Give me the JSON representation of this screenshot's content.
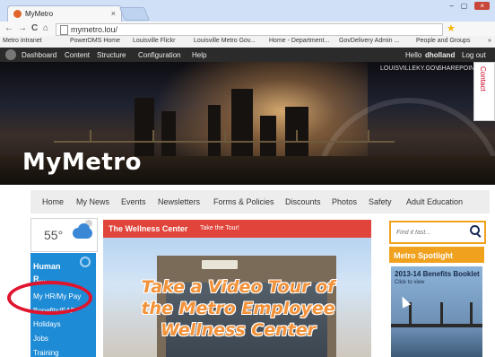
{
  "browser": {
    "tab_title": "MyMetro",
    "tab_close": "×",
    "url": "mymetro.lou/",
    "window_controls": [
      "–",
      "▢",
      "×"
    ],
    "nav": {
      "back": "←",
      "forward": "→",
      "reload": "C",
      "home": "⌂"
    },
    "bookmarks": [
      "Metro Intranet",
      "PowerDMS Home",
      "Louisville Flickr",
      "Louisville Metro Gov...",
      "Home - Department...",
      "GovDelivery Admin ...",
      "People and Groups"
    ],
    "bookmarks_overflow": "»"
  },
  "admin_bar": {
    "items": [
      "Dashboard",
      "Content",
      "Structure",
      "Configuration",
      "Help"
    ],
    "hello": "Hello",
    "user": "dholland",
    "logout": "Log out"
  },
  "top_links": [
    "LOUISVILLEKY.GOV",
    "SHAREPOINT"
  ],
  "site": {
    "logo": "MyMetro",
    "contact": "Contact"
  },
  "main_nav": [
    "Home",
    "My News",
    "Events",
    "Newsletters",
    "Forms & Policies",
    "Discounts",
    "Photos",
    "Safety",
    "Adult Education"
  ],
  "weather": {
    "temp": "55°",
    "icon": "partly-cloudy-icon"
  },
  "hr_panel": {
    "title": "Human",
    "subtitle": "R...",
    "items": [
      "My HR/My Pay",
      "Benefits/EAP",
      "Holidays",
      "Jobs",
      "Training"
    ]
  },
  "wellness": {
    "header": "The Wellness Center",
    "tour_link": "Take the Tour!",
    "overlay_lines": [
      "Take a Video Tour of",
      "the Metro Employee",
      "Wellness Center"
    ]
  },
  "search": {
    "placeholder": "Find it fast..."
  },
  "spotlight": {
    "header": "Metro Spotlight",
    "image_title": "2013-14 Benefits Booklet",
    "image_caption": "Click to view"
  },
  "colors": {
    "accent_red": "#e0443a",
    "accent_orange": "#f0a21e",
    "hr_blue": "#1e8bd6",
    "highlight_oval": "#e0142d"
  }
}
